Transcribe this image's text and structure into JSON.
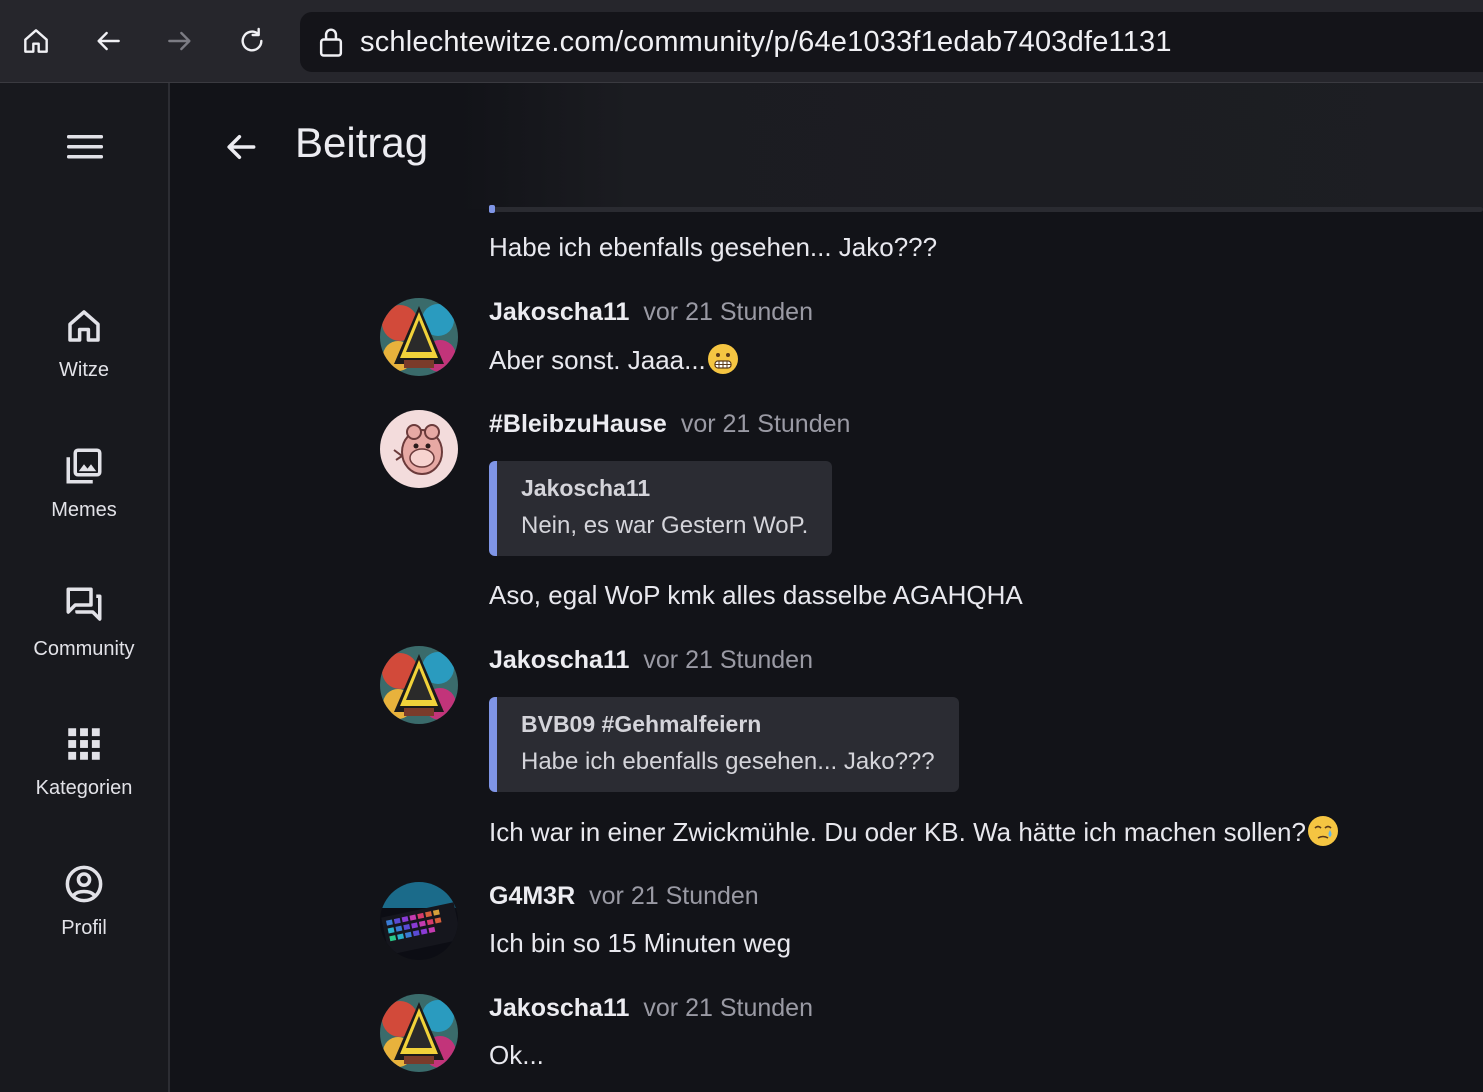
{
  "browser": {
    "url": "schlechtewitze.com/community/p/64e1033f1edab7403dfe1131"
  },
  "sidebar": {
    "items": [
      {
        "label": "Witze",
        "icon": "home-icon"
      },
      {
        "label": "Memes",
        "icon": "image-library-icon"
      },
      {
        "label": "Community",
        "icon": "forum-icon"
      },
      {
        "label": "Kategorien",
        "icon": "grid-icon"
      },
      {
        "label": "Profil",
        "icon": "account-circle-icon"
      }
    ]
  },
  "header": {
    "title": "Beitrag"
  },
  "top_text": "Habe ich ebenfalls gesehen... Jako???",
  "comments": [
    {
      "author": "Jakoscha11",
      "time": "vor 21 Stunden",
      "text": "Aber sonst. Jaaa...",
      "emoji": "grimacing-face"
    },
    {
      "author": "#BleibzuHause",
      "time": "vor 21 Stunden",
      "quote": {
        "author": "Jakoscha11",
        "text": "Nein, es war Gestern WoP."
      },
      "text": "Aso, egal WoP kmk alles dasselbe AGAHQHA"
    },
    {
      "author": "Jakoscha11",
      "time": "vor 21 Stunden",
      "quote": {
        "author": "BVB09 #Gehmalfeiern",
        "text": "Habe ich ebenfalls gesehen... Jako???"
      },
      "text": "Ich war in einer Zwickmühle. Du oder KB. Wa hätte ich machen sollen?",
      "emoji": "crying-face"
    },
    {
      "author": "G4M3R",
      "time": "vor 21 Stunden",
      "text": "Ich bin so 15 Minuten weg"
    },
    {
      "author": "Jakoscha11",
      "time": "vor 21 Stunden",
      "text": "Ok..."
    }
  ],
  "colors": {
    "background": "#121318",
    "accent": "#7f95e6",
    "quote_bg": "#2b2c33"
  }
}
